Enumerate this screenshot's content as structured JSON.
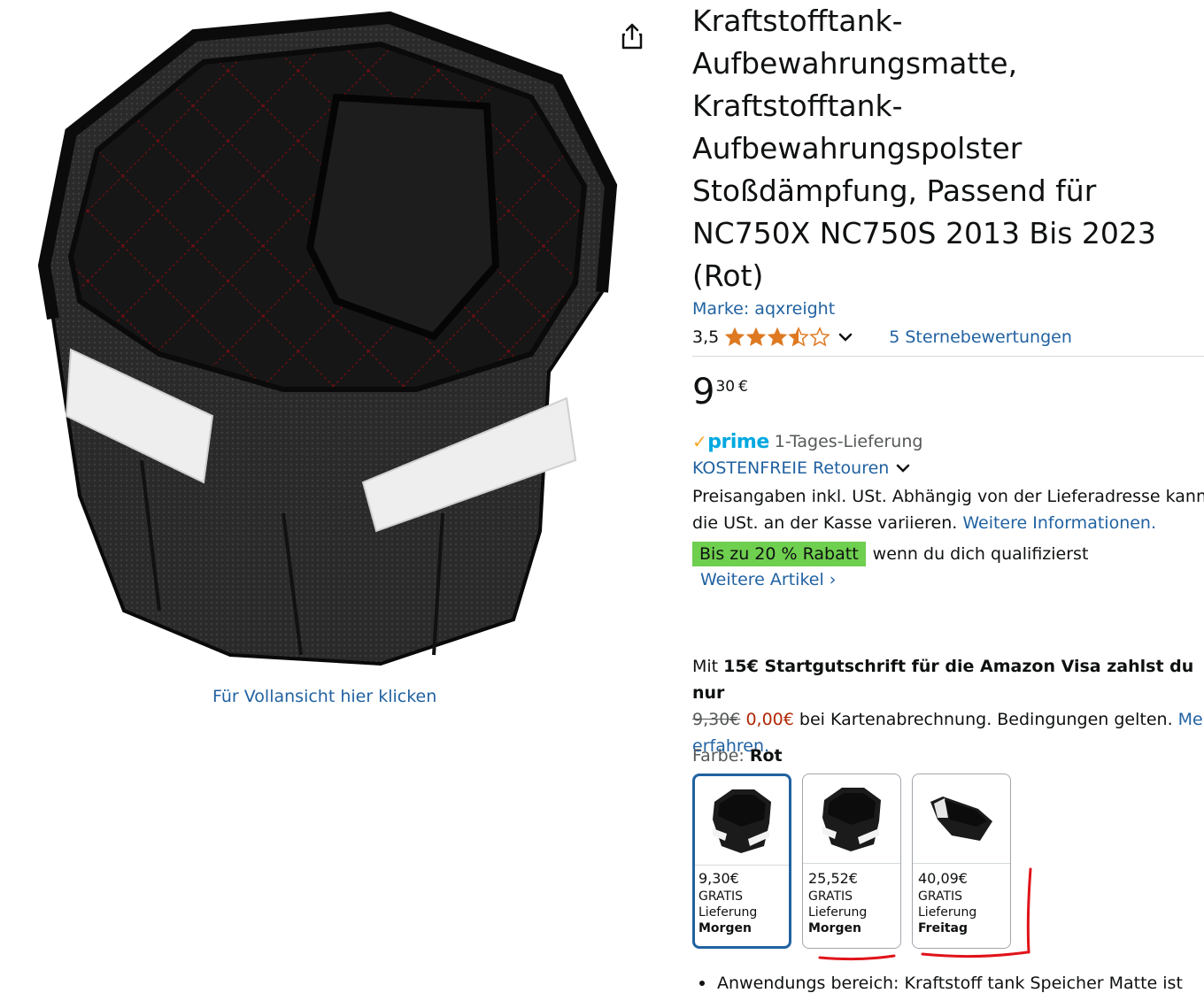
{
  "product": {
    "title": "Kraftstofftank-Aufbewahrungsmatte, Kraftstofftank-Aufbewahrungspolster Stoßdämpfung, Passend für NC750X NC750S 2013 Bis 2023 (Rot)",
    "brand": "Marke: aqxreight",
    "rating_value": "3,5",
    "rating_stars": 3.5,
    "rating_count": "5 Sternebewertungen"
  },
  "gallery": {
    "fullview_label": "Für Vollansicht hier klicken"
  },
  "price": {
    "whole": "9",
    "fraction": "30",
    "currency": "€"
  },
  "delivery": {
    "prime_logo": "prime",
    "prime_text": "1-Tages-Lieferung",
    "returns": "KOSTENFREIE Retouren",
    "tax_note": "Preisangaben inkl. USt. Abhängig von der Lieferadresse kann die USt. an der Kasse variieren.",
    "tax_link": "Weitere Informationen."
  },
  "discount": {
    "badge": "Bis zu 20 % Rabatt",
    "text": "wenn du dich qualifizierst",
    "more_items": "Weitere Artikel ›"
  },
  "visa": {
    "prefix": "Mit",
    "bold": "15€ Startgutschrift für die Amazon Visa zahlst du nur",
    "old_price": "9,30€",
    "new_price": "0,00€",
    "suffix": "bei Kartenabrechnung. Bedingungen gelten.",
    "link": "Mehr erfahren."
  },
  "color": {
    "label": "Farbe:",
    "selected": "Rot",
    "options": [
      {
        "price": "9,30€",
        "shipping": "GRATIS",
        "delivery": "Lieferung",
        "day": "Morgen"
      },
      {
        "price": "25,52€",
        "shipping": "GRATIS",
        "delivery": "Lieferung",
        "day": "Morgen"
      },
      {
        "price": "40,09€",
        "shipping": "GRATIS",
        "delivery": "Lieferung",
        "day": "Freitag"
      }
    ]
  },
  "bullets": {
    "first": "Anwendungs bereich: Kraftstoff tank Speicher Matte ist"
  },
  "colors": {
    "link": "#2162a1",
    "selected_border": "#2162a1",
    "discount_badge": "#6fcf4f",
    "prime": "#00a8e1",
    "annotation_red": "#e0131a"
  },
  "icons": {
    "share": "share-icon",
    "star": "star-icon",
    "chevron": "chevron-down-icon"
  }
}
